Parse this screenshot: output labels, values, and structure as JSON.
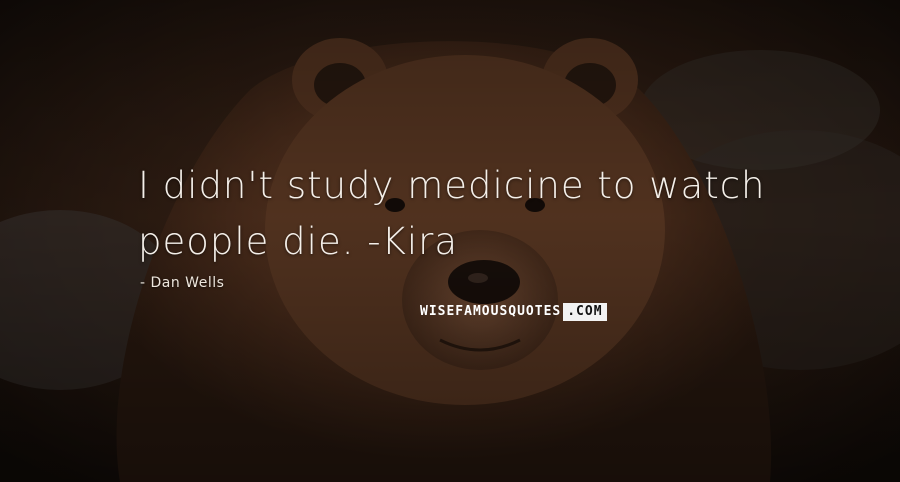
{
  "quote": {
    "line1": "I didn't study medicine to watch",
    "line2": "people die. -Kira"
  },
  "author": "- Dan Wells",
  "brand": {
    "part1": "WISEFAMOUSQUOTES",
    "part2": ".COM"
  },
  "background": {
    "subject_icon": "brown-bear-photo",
    "tone": "#3b2618"
  }
}
